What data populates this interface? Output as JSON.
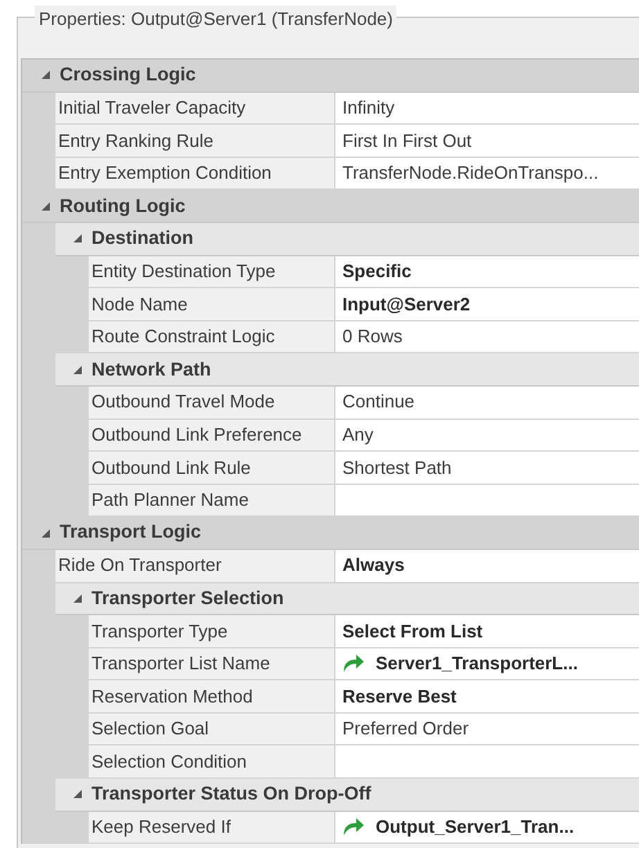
{
  "panel": {
    "title": "Properties: Output@Server1 (TransferNode)"
  },
  "items": [
    {
      "kind": "category",
      "label": "Crossing Logic",
      "expanded": true,
      "children": [
        {
          "kind": "property",
          "label": "Initial Traveler Capacity",
          "value": "Infinity",
          "bold": false,
          "reference": false
        },
        {
          "kind": "property",
          "label": "Entry Ranking Rule",
          "value": "First In First Out",
          "bold": false,
          "reference": false
        },
        {
          "kind": "property",
          "label": "Entry Exemption Condition",
          "value": "TransferNode.RideOnTranspo...",
          "bold": false,
          "reference": false
        }
      ]
    },
    {
      "kind": "category",
      "label": "Routing Logic",
      "expanded": true,
      "children": [
        {
          "kind": "category",
          "label": "Destination",
          "expanded": true,
          "children": [
            {
              "kind": "property",
              "label": "Entity Destination Type",
              "value": "Specific",
              "bold": true,
              "reference": false
            },
            {
              "kind": "property",
              "label": "Node Name",
              "value": "Input@Server2",
              "bold": true,
              "reference": false
            },
            {
              "kind": "property",
              "label": "Route Constraint Logic",
              "value": "0 Rows",
              "bold": false,
              "reference": false
            }
          ]
        },
        {
          "kind": "category",
          "label": "Network Path",
          "expanded": true,
          "children": [
            {
              "kind": "property",
              "label": "Outbound Travel Mode",
              "value": "Continue",
              "bold": false,
              "reference": false
            },
            {
              "kind": "property",
              "label": "Outbound Link Preference",
              "value": "Any",
              "bold": false,
              "reference": false
            },
            {
              "kind": "property",
              "label": "Outbound Link Rule",
              "value": "Shortest Path",
              "bold": false,
              "reference": false
            },
            {
              "kind": "property",
              "label": "Path Planner Name",
              "bold": false,
              "reference": false
            }
          ]
        }
      ]
    },
    {
      "kind": "category",
      "label": "Transport Logic",
      "expanded": true,
      "children": [
        {
          "kind": "property",
          "label": "Ride On Transporter",
          "value": "Always",
          "bold": true,
          "reference": false
        },
        {
          "kind": "category",
          "label": "Transporter Selection",
          "expanded": true,
          "children": [
            {
              "kind": "property",
              "label": "Transporter Type",
              "value": "Select From List",
              "bold": true,
              "reference": false
            },
            {
              "kind": "property",
              "label": "Transporter List Name",
              "value": "Server1_TransporterL...",
              "bold": true,
              "reference": true
            },
            {
              "kind": "property",
              "label": "Reservation Method",
              "value": "Reserve Best",
              "bold": true,
              "reference": false
            },
            {
              "kind": "property",
              "label": "Selection Goal",
              "value": "Preferred Order",
              "bold": false,
              "reference": false
            },
            {
              "kind": "property",
              "label": "Selection Condition",
              "bold": false,
              "reference": false
            }
          ]
        },
        {
          "kind": "category",
          "label": "Transporter Status On Drop-Off",
          "expanded": true,
          "children": [
            {
              "kind": "property",
              "label": "Keep Reserved If",
              "value": "Output_Server1_Tran...",
              "bold": true,
              "reference": true
            }
          ]
        }
      ]
    }
  ]
}
